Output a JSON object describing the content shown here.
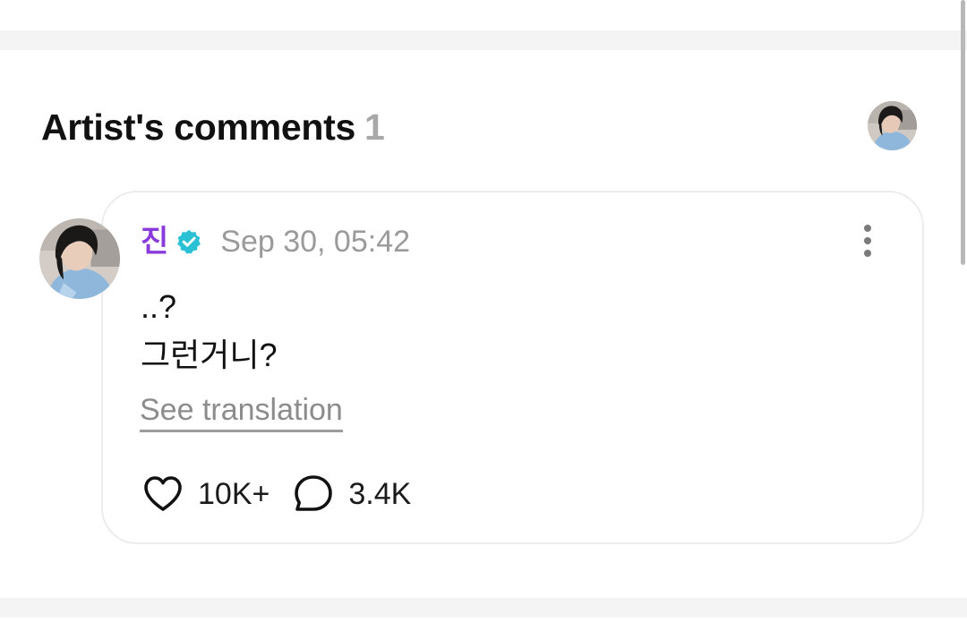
{
  "section": {
    "title": "Artist's comments",
    "count": "1"
  },
  "comment": {
    "author": "진",
    "verified": true,
    "date": "Sep 30, 05:42",
    "lines": [
      "..?",
      "그런거니?"
    ],
    "see_translation": "See translation",
    "likes": "10K+",
    "replies": "3.4K"
  },
  "colors": {
    "author_name": "#8a3bdc",
    "verified_badge": "#2bc1d4",
    "date_text": "#9a9a9a",
    "count_text": "#a8a8a8",
    "band_background": "#f4f4f4",
    "card_border": "#ececec"
  },
  "icons": {
    "verified": "verified-check-icon",
    "more": "more-vertical-icon",
    "like": "heart-icon",
    "reply": "speech-bubble-icon"
  }
}
